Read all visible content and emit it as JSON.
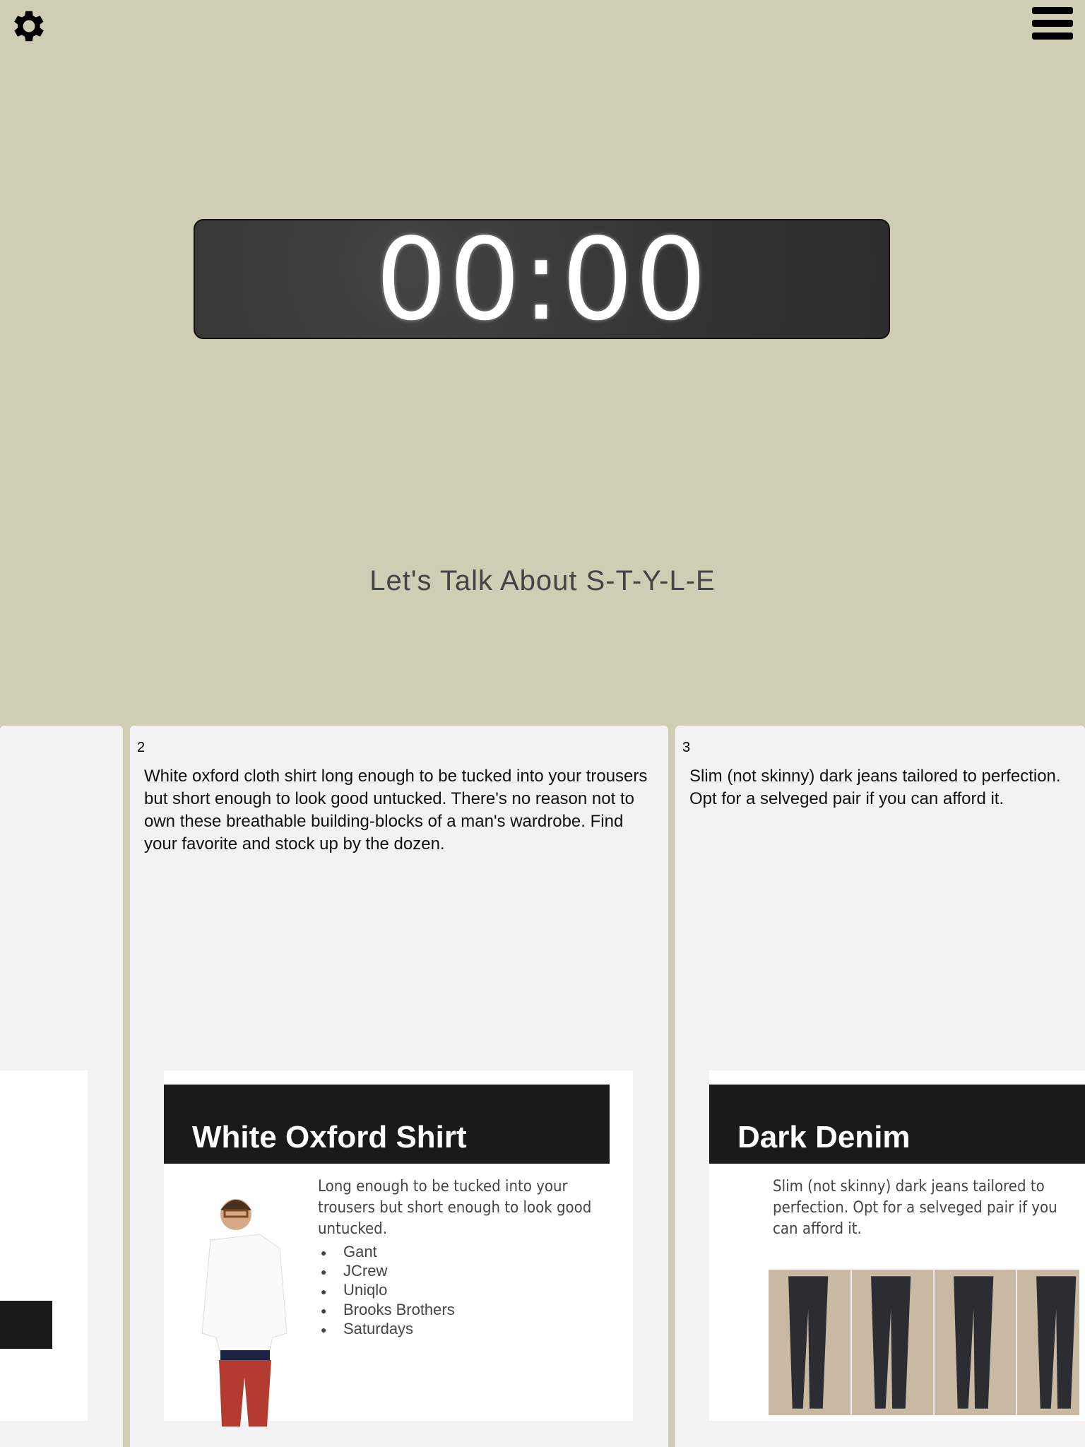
{
  "header": {
    "settings_icon": "gear-icon",
    "menu_icon": "hamburger-menu-icon"
  },
  "timer": {
    "value": "00:00"
  },
  "presentation_title": "Let's Talk About S-T-Y-L-E",
  "cards": [
    {
      "number": "2",
      "text": "White oxford cloth shirt long enough to be tucked into your trousers but short enough to look good untucked. There's no reason not to own these breathable building-blocks of a man's wardrobe. Find your favorite and stock up by the dozen.",
      "slide": {
        "title": "White Oxford Shirt",
        "description": "Long enough to be tucked into your trousers but short enough to look good untucked.",
        "brands": [
          "Gant",
          "JCrew",
          "Uniqlo",
          "Brooks Brothers",
          "Saturdays"
        ]
      }
    },
    {
      "number": "3",
      "text": "Slim (not skinny) dark jeans tailored to perfection. Opt for a selveged pair if you can afford it.",
      "slide": {
        "title": "Dark Denim",
        "description": "Slim (not skinny) dark jeans tailored to perfection. Opt for a selveged pair if you can afford it."
      }
    }
  ],
  "colors": {
    "background": "#cfcdb3",
    "card": "#f2f2f2",
    "slide_header": "#1a1a1a"
  }
}
